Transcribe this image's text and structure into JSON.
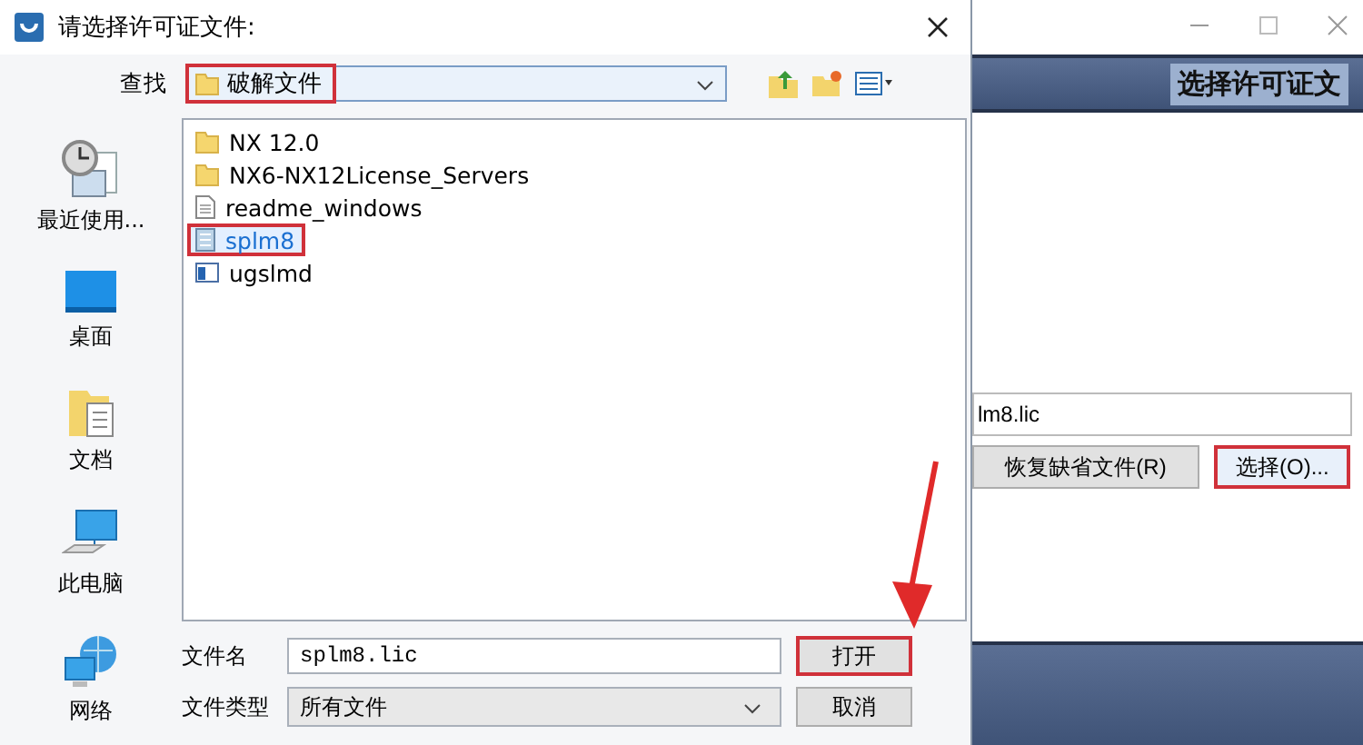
{
  "dialog": {
    "title": "请选择许可证文件:",
    "look_in": {
      "label": "查找",
      "folder": "破解文件",
      "highlighted": true
    },
    "places": [
      {
        "kind": "recent",
        "label": "最近使用..."
      },
      {
        "kind": "desktop",
        "label": "桌面"
      },
      {
        "kind": "documents",
        "label": "文档"
      },
      {
        "kind": "computer",
        "label": "此电脑"
      },
      {
        "kind": "network",
        "label": "网络"
      }
    ],
    "files": [
      {
        "kind": "folder",
        "name": "NX 12.0",
        "selected": false,
        "highlighted": false
      },
      {
        "kind": "folder",
        "name": "NX6-NX12License_Servers",
        "selected": false,
        "highlighted": false
      },
      {
        "kind": "text",
        "name": "readme_windows",
        "selected": false,
        "highlighted": false
      },
      {
        "kind": "config",
        "name": "splm8",
        "selected": true,
        "highlighted": true
      },
      {
        "kind": "program",
        "name": "ugslmd",
        "selected": false,
        "highlighted": false
      }
    ],
    "file_name": {
      "label": "文件名",
      "value": "splm8.lic"
    },
    "file_type": {
      "label": "文件类型",
      "value": "所有文件"
    },
    "buttons": [
      {
        "label": "打开",
        "highlighted": true
      },
      {
        "label": "取消",
        "highlighted": false
      }
    ]
  },
  "license_window": {
    "banner": "选择许可证文",
    "path_value": "lm8.lic",
    "buttons": [
      {
        "label": "恢复缺省文件(R)",
        "highlighted": false
      },
      {
        "label": "选择(O)...",
        "highlighted": true
      }
    ]
  }
}
